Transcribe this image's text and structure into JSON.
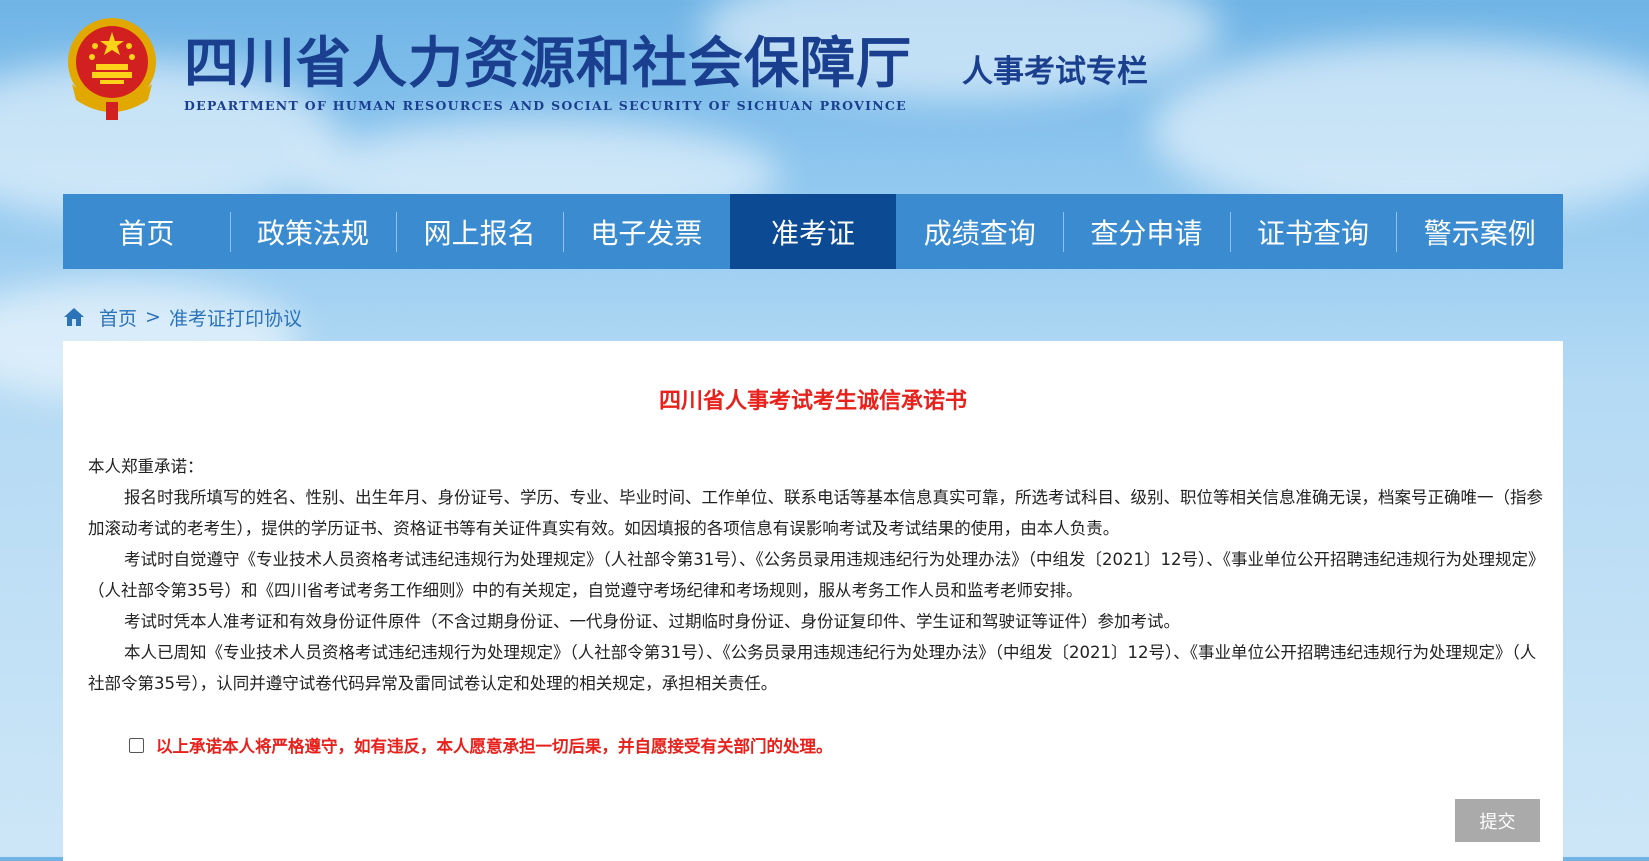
{
  "header": {
    "title_cn": "四川省人力资源和社会保障厅",
    "title_en": "DEPARTMENT OF HUMAN RESOURCES AND SOCIAL SECURITY OF SICHUAN PROVINCE",
    "section": "人事考试专栏",
    "emblem_icon": "national-emblem-icon"
  },
  "nav": {
    "items": [
      {
        "label": "首页"
      },
      {
        "label": "政策法规"
      },
      {
        "label": "网上报名"
      },
      {
        "label": "电子发票"
      },
      {
        "label": "准考证"
      },
      {
        "label": "成绩查询"
      },
      {
        "label": "查分申请"
      },
      {
        "label": "证书查询"
      },
      {
        "label": "警示案例"
      }
    ],
    "active_index": 4
  },
  "breadcrumb": {
    "home": "首页",
    "separator": ">",
    "current": "准考证打印协议"
  },
  "document": {
    "title": "四川省人事考试考生诚信承诺书",
    "intro": "本人郑重承诺：",
    "paragraphs": [
      "报名时我所填写的姓名、性别、出生年月、身份证号、学历、专业、毕业时间、工作单位、联系电话等基本信息真实可靠，所选考试科目、级别、职位等相关信息准确无误，档案号正确唯一（指参加滚动考试的老考生），提供的学历证书、资格证书等有关证件真实有效。如因填报的各项信息有误影响考试及考试结果的使用，由本人负责。",
      "考试时自觉遵守《专业技术人员资格考试违纪违规行为处理规定》（人社部令第31号）、《公务员录用违规违纪行为处理办法》（中组发〔2021〕12号）、《事业单位公开招聘违纪违规行为处理规定》（人社部令第35号）和《四川省考试考务工作细则》中的有关规定，自觉遵守考场纪律和考场规则，服从考务工作人员和监考老师安排。",
      "考试时凭本人准考证和有效身份证件原件（不含过期身份证、一代身份证、过期临时身份证、身份证复印件、学生证和驾驶证等证件）参加考试。",
      "本人已周知《专业技术人员资格考试违纪违规行为处理规定》（人社部令第31号）、《公务员录用违规违纪行为处理办法》（中组发〔2021〕12号）、《事业单位公开招聘违纪违规行为处理规定》（人社部令第35号），认同并遵守试卷代码异常及雷同试卷认定和处理的相关规定，承担相关责任。"
    ],
    "agree_label": "以上承诺本人将严格遵守，如有违反，本人愿意承担一切后果，并自愿接受有关部门的处理。",
    "agree_checked": false,
    "submit_label": "提交"
  },
  "colors": {
    "nav_bg": "#3a8bd0",
    "nav_active": "#0c4a94",
    "title_red": "#e8211c",
    "header_blue": "#1b3f8f",
    "submit_disabled": "#aaaaaa"
  }
}
